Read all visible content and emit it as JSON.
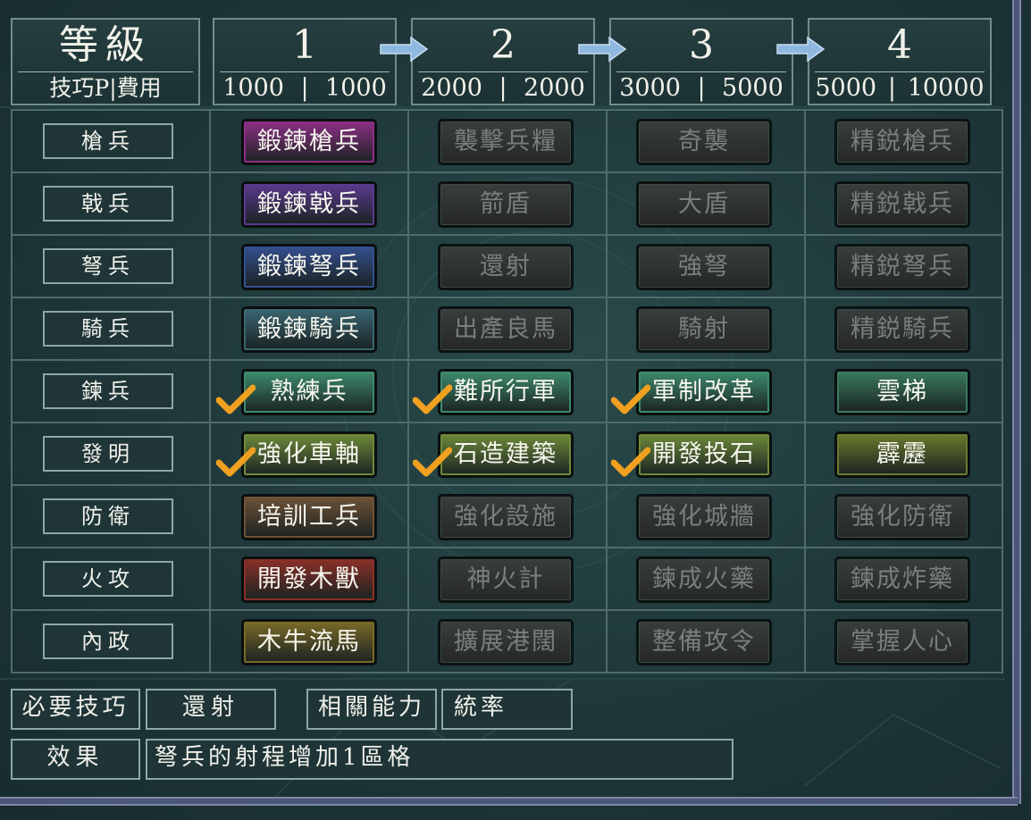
{
  "header": {
    "level_label": "等級",
    "cost_label": "技巧P|費用",
    "levels": [
      {
        "label": "1",
        "p": "1000",
        "cost": "1000"
      },
      {
        "label": "2",
        "p": "2000",
        "cost": "2000"
      },
      {
        "label": "3",
        "p": "3000",
        "cost": "5000"
      },
      {
        "label": "4",
        "p": "5000",
        "cost": "10000"
      }
    ]
  },
  "rows": [
    {
      "label": "槍兵",
      "cells": [
        {
          "text": "鍛鍊槍兵",
          "state": "active",
          "color": "#8d2f86"
        },
        {
          "text": "襲擊兵糧",
          "state": "locked"
        },
        {
          "text": "奇襲",
          "state": "locked"
        },
        {
          "text": "精鋭槍兵",
          "state": "locked"
        }
      ]
    },
    {
      "label": "戟兵",
      "cells": [
        {
          "text": "鍛鍊戟兵",
          "state": "active",
          "color": "#5b3a8e"
        },
        {
          "text": "箭盾",
          "state": "locked"
        },
        {
          "text": "大盾",
          "state": "locked"
        },
        {
          "text": "精鋭戟兵",
          "state": "locked"
        }
      ]
    },
    {
      "label": "弩兵",
      "cells": [
        {
          "text": "鍛鍊弩兵",
          "state": "active",
          "color": "#34508e"
        },
        {
          "text": "還射",
          "state": "locked"
        },
        {
          "text": "強弩",
          "state": "locked"
        },
        {
          "text": "精鋭弩兵",
          "state": "locked"
        }
      ]
    },
    {
      "label": "騎兵",
      "cells": [
        {
          "text": "鍛鍊騎兵",
          "state": "active",
          "color": "#3a6672"
        },
        {
          "text": "出產良馬",
          "state": "locked"
        },
        {
          "text": "騎射",
          "state": "locked"
        },
        {
          "text": "精鋭騎兵",
          "state": "locked"
        }
      ]
    },
    {
      "label": "鍊兵",
      "cells": [
        {
          "text": "熟練兵",
          "state": "active",
          "color": "#3e8a6e",
          "check": true
        },
        {
          "text": "難所行軍",
          "state": "active",
          "color": "#3e8a6e",
          "check": true
        },
        {
          "text": "軍制改革",
          "state": "active",
          "color": "#3e8a6e",
          "check": true
        },
        {
          "text": "雲梯",
          "state": "active",
          "color": "#3a7a5e"
        }
      ]
    },
    {
      "label": "發明",
      "cells": [
        {
          "text": "強化車軸",
          "state": "active",
          "color": "#6e8a3a",
          "check": true
        },
        {
          "text": "石造建築",
          "state": "active",
          "color": "#6e8a3a",
          "check": true
        },
        {
          "text": "開發投石",
          "state": "active",
          "color": "#6e8a3a",
          "check": true
        },
        {
          "text": "霹靂",
          "state": "active",
          "color": "#6a7a2e"
        }
      ]
    },
    {
      "label": "防衛",
      "cells": [
        {
          "text": "培訓工兵",
          "state": "active",
          "color": "#6e5236"
        },
        {
          "text": "強化設施",
          "state": "locked"
        },
        {
          "text": "強化城牆",
          "state": "locked"
        },
        {
          "text": "強化防衛",
          "state": "locked"
        }
      ]
    },
    {
      "label": "火攻",
      "cells": [
        {
          "text": "開發木獸",
          "state": "active",
          "color": "#8a3028"
        },
        {
          "text": "神火計",
          "state": "locked"
        },
        {
          "text": "鍊成火藥",
          "state": "locked"
        },
        {
          "text": "鍊成炸藥",
          "state": "locked"
        }
      ]
    },
    {
      "label": "內政",
      "cells": [
        {
          "text": "木牛流馬",
          "state": "active",
          "color": "#7a6a26"
        },
        {
          "text": "擴展港闊",
          "state": "locked"
        },
        {
          "text": "整備攻令",
          "state": "locked"
        },
        {
          "text": "掌握人心",
          "state": "locked"
        }
      ]
    }
  ],
  "footer": {
    "required_label": "必要技巧",
    "required_value": "還射",
    "related_label": "相關能力",
    "related_value": "統率",
    "effect_label": "效果",
    "effect_value": "弩兵的射程增加1區格"
  },
  "icons": {
    "arrow": "right-arrow-icon",
    "check": "checkmark-icon"
  },
  "colors": {
    "accent_check": "#f0a020",
    "panel_bg": "#1d3537",
    "frame": "#4c557a"
  }
}
